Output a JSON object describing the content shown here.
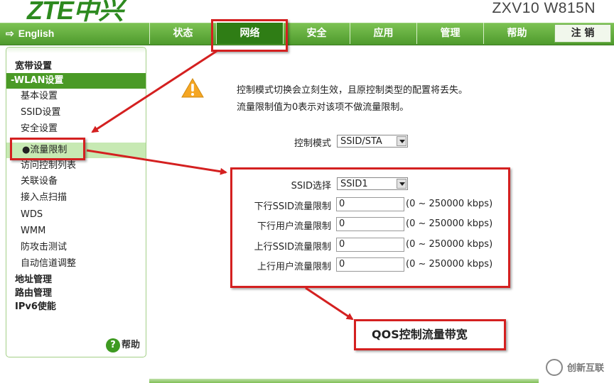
{
  "header": {
    "logo": "ZTE中兴",
    "model": "ZXV10 W815N"
  },
  "nav": {
    "language": "English",
    "tabs": [
      {
        "label": "状态",
        "active": false
      },
      {
        "label": "网络",
        "active": true
      },
      {
        "label": "安全",
        "active": false
      },
      {
        "label": "应用",
        "active": false
      },
      {
        "label": "管理",
        "active": false
      },
      {
        "label": "帮助",
        "active": false
      }
    ],
    "logout": "注 销"
  },
  "sidebar": {
    "broadband": "宽带设置",
    "wlan_group": "-WLAN设置",
    "wlan_items": [
      "基本设置",
      "SSID设置",
      "安全设置",
      "●流量限制",
      "访问控制列表",
      "关联设备",
      "接入点扫描",
      "WDS",
      "WMM",
      "防攻击测试",
      "自动信道调整"
    ],
    "active_item": "●流量限制",
    "address": "地址管理",
    "routing": "路由管理",
    "ipv6": "IPv6使能",
    "help_icon": "?",
    "help_label": "帮助"
  },
  "content": {
    "note1": "控制模式切换会立刻生效，且原控制类型的配置将丢失。",
    "note2": "流量限制值为0表示对该项不做流量限制。",
    "control_mode_label": "控制模式",
    "control_mode_value": "SSID/STA",
    "ssid_select_label": "SSID选择",
    "ssid_select_value": "SSID1",
    "limits": [
      {
        "label": "下行SSID流量限制",
        "value": "0",
        "range": "(0 ~ 250000 kbps)"
      },
      {
        "label": "下行用户流量限制",
        "value": "0",
        "range": "(0 ~ 250000 kbps)"
      },
      {
        "label": "上行SSID流量限制",
        "value": "0",
        "range": "(0 ~ 250000 kbps)"
      },
      {
        "label": "上行用户流量限制",
        "value": "0",
        "range": "(0 ~ 250000 kbps)"
      }
    ]
  },
  "annotation": {
    "callout": "QOS控制流量带宽",
    "color": "#d42020"
  },
  "watermark": {
    "text": "创新互联"
  },
  "colors": {
    "brand_green": "#4e9a2c",
    "active_tab": "#2f7d15",
    "warning": "#f5a623"
  }
}
